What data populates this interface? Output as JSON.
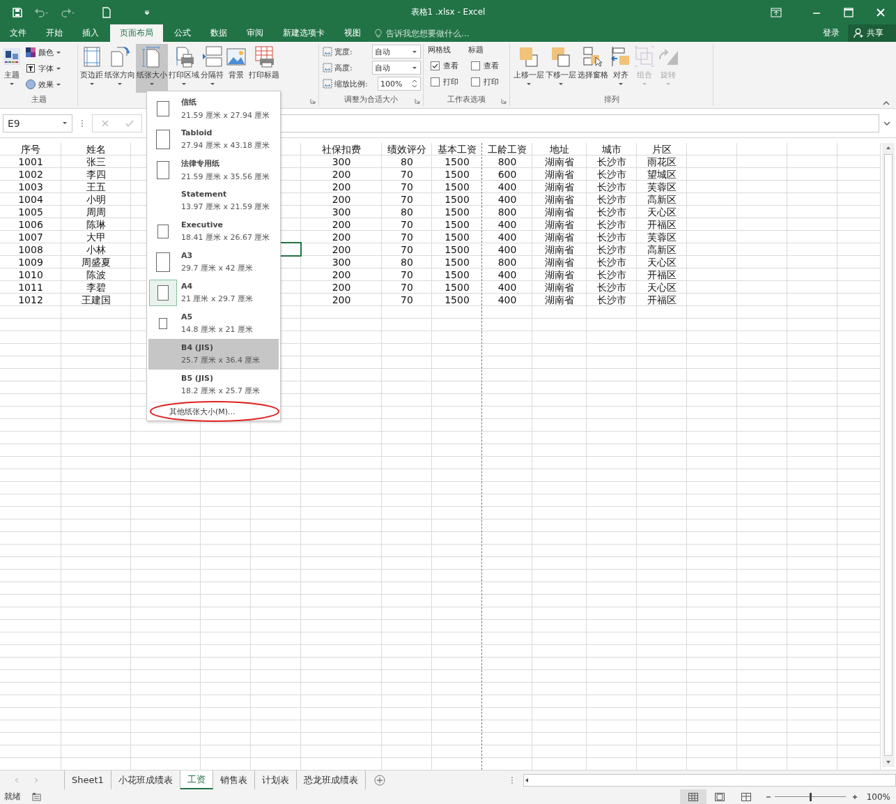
{
  "window": {
    "title": "表格1 .xlsx - Excel"
  },
  "tabs": [
    {
      "label": "文件",
      "selected": false
    },
    {
      "label": "开始",
      "selected": false
    },
    {
      "label": "插入",
      "selected": false
    },
    {
      "label": "页面布局",
      "selected": true
    },
    {
      "label": "公式",
      "selected": false
    },
    {
      "label": "数据",
      "selected": false
    },
    {
      "label": "审阅",
      "selected": false
    },
    {
      "label": "新建选项卡",
      "selected": false
    },
    {
      "label": "视图",
      "selected": false
    }
  ],
  "tell_me": {
    "placeholder": "告诉我您想要做什么..."
  },
  "account": {
    "sign_in": "登录",
    "share": "共享"
  },
  "ribbon": {
    "themes": {
      "label": "主题",
      "main": {
        "label": "主题",
        "dropdown": true
      },
      "options": [
        {
          "label": "颜色",
          "dropdown": true
        },
        {
          "label": "字体",
          "dropdown": true
        },
        {
          "label": "效果",
          "dropdown": true
        }
      ]
    },
    "page_setup": {
      "buttons": [
        {
          "label": "页边距",
          "dropdown": true,
          "pressed": false
        },
        {
          "label": "纸张方向",
          "dropdown": true,
          "pressed": false
        },
        {
          "label": "纸张大小",
          "dropdown": true,
          "pressed": true
        },
        {
          "label": "打印区域",
          "dropdown": true,
          "pressed": false
        },
        {
          "label": "分隔符",
          "dropdown": true,
          "pressed": false
        },
        {
          "label": "背景",
          "dropdown": false,
          "pressed": false
        },
        {
          "label": "打印标题",
          "dropdown": false,
          "pressed": false
        }
      ]
    },
    "scale_to_fit": {
      "label": "调整为合适大小",
      "fields": [
        {
          "label": "宽度:",
          "value": "自动",
          "kind": "dropdown"
        },
        {
          "label": "高度:",
          "value": "自动",
          "kind": "dropdown"
        },
        {
          "label": "缩放比例:",
          "value": "100%",
          "kind": "spinner"
        }
      ]
    },
    "sheet_options": {
      "label": "工作表选项",
      "columns": [
        {
          "heading": "网格线",
          "options": [
            {
              "label": "查看",
              "checked": true
            },
            {
              "label": "打印",
              "checked": false
            }
          ]
        },
        {
          "heading": "标题",
          "options": [
            {
              "label": "查看",
              "checked": false
            },
            {
              "label": "打印",
              "checked": false
            }
          ]
        }
      ]
    },
    "arrange": {
      "label": "排列",
      "buttons": [
        {
          "label": "上移一层",
          "dropdown": true,
          "disabled": false
        },
        {
          "label": "下移一层",
          "dropdown": true,
          "disabled": false
        },
        {
          "label": "选择窗格",
          "dropdown": false,
          "disabled": false
        },
        {
          "label": "对齐",
          "dropdown": true,
          "disabled": false
        },
        {
          "label": "组合",
          "dropdown": true,
          "disabled": true
        },
        {
          "label": "旋转",
          "dropdown": true,
          "disabled": true
        }
      ]
    }
  },
  "name_box": "E9",
  "paper_size_menu": {
    "items": [
      {
        "name": "信纸",
        "size": "21.59 厘米 x 27.94 厘米",
        "has_icon": true,
        "selected": false,
        "hovered": false
      },
      {
        "name": "Tabloid",
        "size": "27.94 厘米 x 43.18 厘米",
        "has_icon": true,
        "selected": false,
        "hovered": false
      },
      {
        "name": "法律专用纸",
        "size": "21.59 厘米 x 35.56 厘米",
        "has_icon": true,
        "selected": false,
        "hovered": false
      },
      {
        "name": "Statement",
        "size": "13.97 厘米 x 21.59 厘米",
        "has_icon": false,
        "selected": false,
        "hovered": false
      },
      {
        "name": "Executive",
        "size": "18.41 厘米 x 26.67 厘米",
        "has_icon": true,
        "selected": false,
        "hovered": false
      },
      {
        "name": "A3",
        "size": "29.7 厘米 x 42 厘米",
        "has_icon": true,
        "selected": false,
        "hovered": false
      },
      {
        "name": "A4",
        "size": "21 厘米 x 29.7 厘米",
        "has_icon": true,
        "selected": true,
        "hovered": false
      },
      {
        "name": "A5",
        "size": "14.8 厘米 x 21 厘米",
        "has_icon": true,
        "selected": false,
        "hovered": false
      },
      {
        "name": "B4 (JIS)",
        "size": "25.7 厘米 x 36.4 厘米",
        "has_icon": false,
        "selected": false,
        "hovered": true
      },
      {
        "name": "B5 (JIS)",
        "size": "18.2 厘米 x 25.7 厘米",
        "has_icon": false,
        "selected": false,
        "hovered": false
      }
    ],
    "more": "其他纸张大小(M)...",
    "more_circled": true
  },
  "table": {
    "columns": [
      "序号",
      "姓名",
      "社保扣费",
      "绩效评分",
      "基本工资",
      "工龄工资",
      "地址",
      "城市",
      "片区"
    ],
    "rows": [
      {
        "cells": [
          "1001",
          "张三",
          "300",
          "80",
          "1500",
          "800",
          "湖南省",
          "长沙市",
          "雨花区"
        ],
        "selected": false
      },
      {
        "cells": [
          "1002",
          "李四",
          "200",
          "70",
          "1500",
          "600",
          "湖南省",
          "长沙市",
          "望城区"
        ],
        "selected": false
      },
      {
        "cells": [
          "1003",
          "王五",
          "200",
          "70",
          "1500",
          "400",
          "湖南省",
          "长沙市",
          "芙蓉区"
        ],
        "selected": false
      },
      {
        "cells": [
          "1004",
          "小明",
          "200",
          "70",
          "1500",
          "400",
          "湖南省",
          "长沙市",
          "高新区"
        ],
        "selected": false
      },
      {
        "cells": [
          "1005",
          "周周",
          "300",
          "80",
          "1500",
          "800",
          "湖南省",
          "长沙市",
          "天心区"
        ],
        "selected": false
      },
      {
        "cells": [
          "1006",
          "陈琳",
          "200",
          "70",
          "1500",
          "400",
          "湖南省",
          "长沙市",
          "开福区"
        ],
        "selected": false
      },
      {
        "cells": [
          "1007",
          "大甲",
          "200",
          "70",
          "1500",
          "400",
          "湖南省",
          "长沙市",
          "芙蓉区"
        ],
        "selected": false
      },
      {
        "cells": [
          "1008",
          "小林",
          "200",
          "70",
          "1500",
          "400",
          "湖南省",
          "长沙市",
          "高新区"
        ],
        "selected": true
      },
      {
        "cells": [
          "1009",
          "周盛夏",
          "300",
          "80",
          "1500",
          "800",
          "湖南省",
          "长沙市",
          "天心区"
        ],
        "selected": false
      },
      {
        "cells": [
          "1010",
          "陈波",
          "200",
          "70",
          "1500",
          "400",
          "湖南省",
          "长沙市",
          "开福区"
        ],
        "selected": false
      },
      {
        "cells": [
          "1011",
          "李碧",
          "200",
          "70",
          "1500",
          "400",
          "湖南省",
          "长沙市",
          "天心区"
        ],
        "selected": false
      },
      {
        "cells": [
          "1012",
          "王建国",
          "200",
          "70",
          "1500",
          "400",
          "湖南省",
          "长沙市",
          "开福区"
        ],
        "selected": false
      }
    ]
  },
  "sheet_tabs": [
    {
      "label": "Sheet1",
      "selected": false
    },
    {
      "label": "小花班成绩表",
      "selected": false
    },
    {
      "label": "工资",
      "selected": true
    },
    {
      "label": "销售表",
      "selected": false
    },
    {
      "label": "计划表",
      "selected": false
    },
    {
      "label": "恐龙班成绩表",
      "selected": false
    }
  ],
  "status_bar": {
    "status": "就绪",
    "views": [
      {
        "selected": true
      },
      {
        "selected": false
      },
      {
        "selected": false
      }
    ],
    "zoom": {
      "level": 0.5,
      "reading": "100%"
    }
  }
}
